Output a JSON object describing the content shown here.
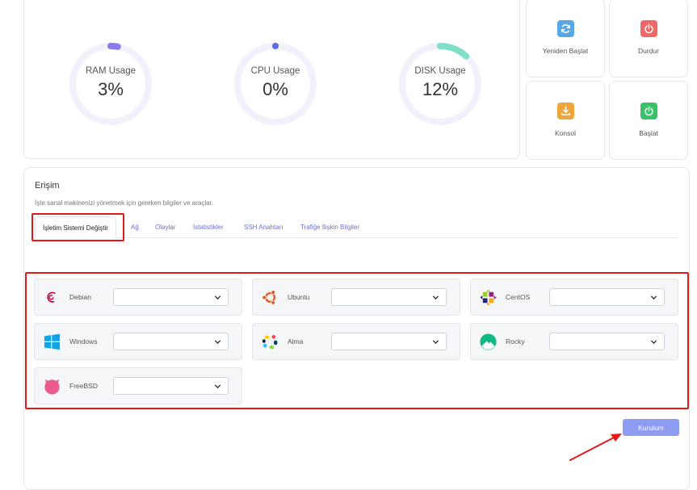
{
  "usage": {
    "ram": {
      "label": "RAM Usage",
      "value": "3%",
      "percent": 3,
      "color": "#8b7bea"
    },
    "cpu": {
      "label": "CPU Usage",
      "value": "0%",
      "percent": 0,
      "color": "#5b6be0"
    },
    "disk": {
      "label": "DISK Usage",
      "value": "12%",
      "percent": 12,
      "color": "#7fe0c7"
    }
  },
  "actions": {
    "restart": {
      "label": "Yeniden Başlat",
      "icon": "refresh-icon",
      "color": "#5aa7e6"
    },
    "stop": {
      "label": "Durdur",
      "icon": "power-icon",
      "color": "#f06767"
    },
    "console": {
      "label": "Konsol",
      "icon": "download-icon",
      "color": "#eea63a"
    },
    "start": {
      "label": "Başlat",
      "icon": "power-icon",
      "color": "#3ac26a"
    }
  },
  "access": {
    "title": "Erişim",
    "subtitle": "İşte sanal makinenizi yönetmek için gereken bilgiler ve araçlar.",
    "tabs": [
      {
        "label": "İşletim Sistemi Değiştir",
        "active": true
      },
      {
        "label": "Ağ"
      },
      {
        "label": "Olaylar"
      },
      {
        "label": "İstatistikler"
      },
      {
        "label": "SSH Anahtarı"
      },
      {
        "label": "Trafiğe İlişkin Bilgiler"
      }
    ]
  },
  "os_options": [
    {
      "name": "Debian",
      "icon": "debian-icon",
      "selected": ""
    },
    {
      "name": "Ubuntu",
      "icon": "ubuntu-icon",
      "selected": ""
    },
    {
      "name": "CentOS",
      "icon": "centos-icon",
      "selected": ""
    },
    {
      "name": "Windows",
      "icon": "windows-icon",
      "selected": ""
    },
    {
      "name": "Alma",
      "icon": "alma-icon",
      "selected": ""
    },
    {
      "name": "Rocky",
      "icon": "rocky-icon",
      "selected": ""
    },
    {
      "name": "FreeBSD",
      "icon": "freebsd-icon",
      "selected": ""
    }
  ],
  "install_button": {
    "label": "Kurulum",
    "color": "#8e9cf3"
  },
  "annotation_color": "#e01919"
}
